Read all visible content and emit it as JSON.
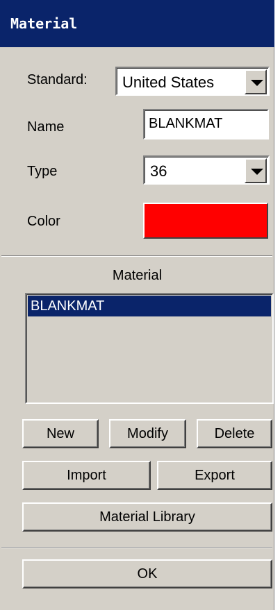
{
  "window": {
    "title": "Material"
  },
  "form": {
    "standard_label": "Standard:",
    "standard_value": "United States",
    "name_label": "Name",
    "name_value": "BLANKMAT",
    "type_label": "Type",
    "type_value": "36",
    "color_label": "Color",
    "color_value": "#ff0000"
  },
  "material_list": {
    "heading": "Material",
    "items": [
      "BLANKMAT"
    ],
    "selected": "BLANKMAT"
  },
  "buttons": {
    "new": "New",
    "modify": "Modify",
    "delete": "Delete",
    "import": "Import",
    "export": "Export",
    "library": "Material Library",
    "ok": "OK"
  },
  "colors": {
    "titlebar": "#0a246a",
    "face": "#d4d0c8",
    "selection": "#0a246a"
  }
}
